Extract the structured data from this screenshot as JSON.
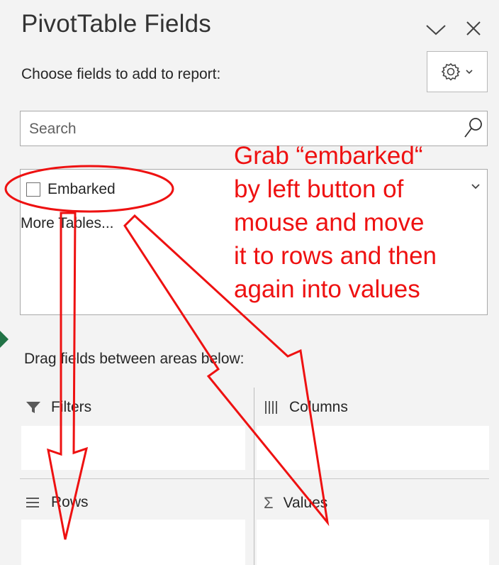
{
  "panel": {
    "title": "PivotTable Fields",
    "subtitle": "Choose fields to add to report:",
    "search_placeholder": "Search"
  },
  "fields": [
    {
      "label": "Embarked",
      "checked": false
    }
  ],
  "more_tables": "More Tables...",
  "drag_hint": "Drag fields between areas below:",
  "areas": {
    "filters": "Filters",
    "columns": "Columns",
    "rows": "Rows",
    "values": "Values"
  },
  "annotation": {
    "lines": [
      "Grab “embarked“",
      "by left button of",
      "mouse and move",
      "it to rows and then",
      "again into values"
    ],
    "color": "#ee1111"
  },
  "icons": {
    "header_menu": "chevron-down-icon",
    "close": "close-icon",
    "tools": "gear-icon",
    "search": "search-icon",
    "filters": "filter-icon",
    "columns": "columns-icon",
    "rows": "rows-icon",
    "values": "sigma-icon"
  }
}
